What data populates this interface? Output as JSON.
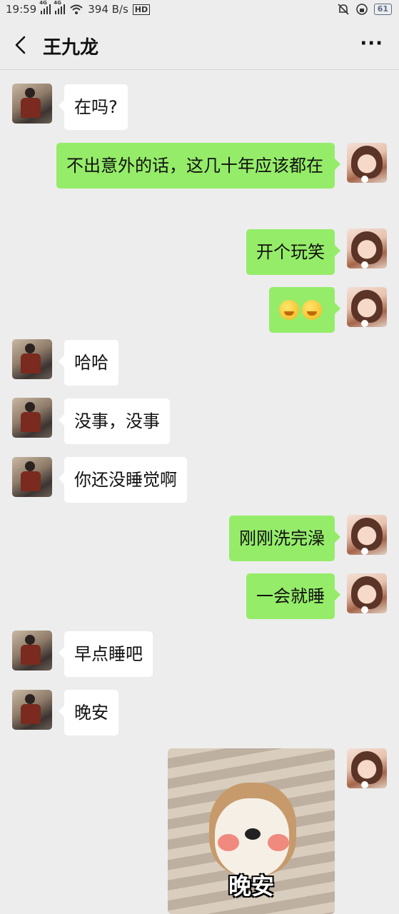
{
  "status_bar": {
    "time": "19:59",
    "net_type_1": "4G",
    "net_type_2": "4G",
    "speed": "394 B/s",
    "hd": "HD",
    "battery": "61"
  },
  "header": {
    "title": "王九龙"
  },
  "messages": [
    {
      "side": "left",
      "text": "在吗?"
    },
    {
      "side": "right",
      "text": "不出意外的话，这几十年应该都在"
    },
    {
      "side": "right",
      "text": "开个玩笑"
    },
    {
      "side": "right",
      "text": "",
      "emoji": [
        "grin-emoji",
        "grin-emoji"
      ]
    },
    {
      "side": "left",
      "text": "哈哈"
    },
    {
      "side": "left",
      "text": "没事，没事"
    },
    {
      "side": "left",
      "text": "你还没睡觉啊"
    },
    {
      "side": "right",
      "text": "刚刚洗完澡"
    },
    {
      "side": "right",
      "text": "一会就睡"
    },
    {
      "side": "left",
      "text": "早点睡吧"
    },
    {
      "side": "left",
      "text": "晚安"
    },
    {
      "side": "right",
      "sticker_text": "晚安"
    }
  ],
  "colors": {
    "background": "#ededed",
    "incoming_bubble": "#ffffff",
    "outgoing_bubble": "#95ec69"
  }
}
